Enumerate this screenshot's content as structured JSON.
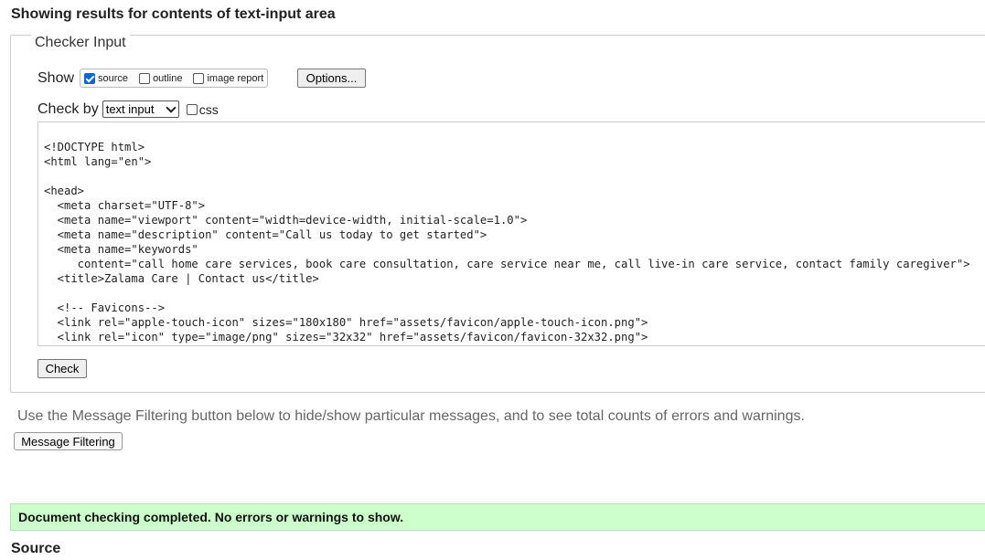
{
  "page": {
    "heading": "Showing results for contents of text-input area"
  },
  "checker": {
    "legend": "Checker Input",
    "show_label": "Show",
    "show_options": [
      {
        "label": "source",
        "checked": true
      },
      {
        "label": "outline",
        "checked": false
      },
      {
        "label": "image report",
        "checked": false
      }
    ],
    "options_button": "Options...",
    "check_by_label": "Check by",
    "check_by_value": "text input",
    "css_label": "css",
    "css_checked": false,
    "source_text": "<!DOCTYPE html>\n<html lang=\"en\">\n\n<head>\n  <meta charset=\"UTF-8\">\n  <meta name=\"viewport\" content=\"width=device-width, initial-scale=1.0\">\n  <meta name=\"description\" content=\"Call us today to get started\">\n  <meta name=\"keywords\"\n     content=\"call home care services, book care consultation, care service near me, call live-in care service, contact family caregiver\">\n  <title>Zalama Care | Contact us</title>\n\n  <!-- Favicons-->\n  <link rel=\"apple-touch-icon\" sizes=\"180x180\" href=\"assets/favicon/apple-touch-icon.png\">\n  <link rel=\"icon\" type=\"image/png\" sizes=\"32x32\" href=\"assets/favicon/favicon-32x32.png\">",
    "check_button": "Check"
  },
  "filter": {
    "info": "Use the Message Filtering button below to hide/show particular messages, and to see total counts of errors and warnings.",
    "button": "Message Filtering"
  },
  "result": {
    "message": "Document checking completed. No errors or warnings to show.",
    "color": "#ccffcc"
  },
  "source_heading": "Source"
}
